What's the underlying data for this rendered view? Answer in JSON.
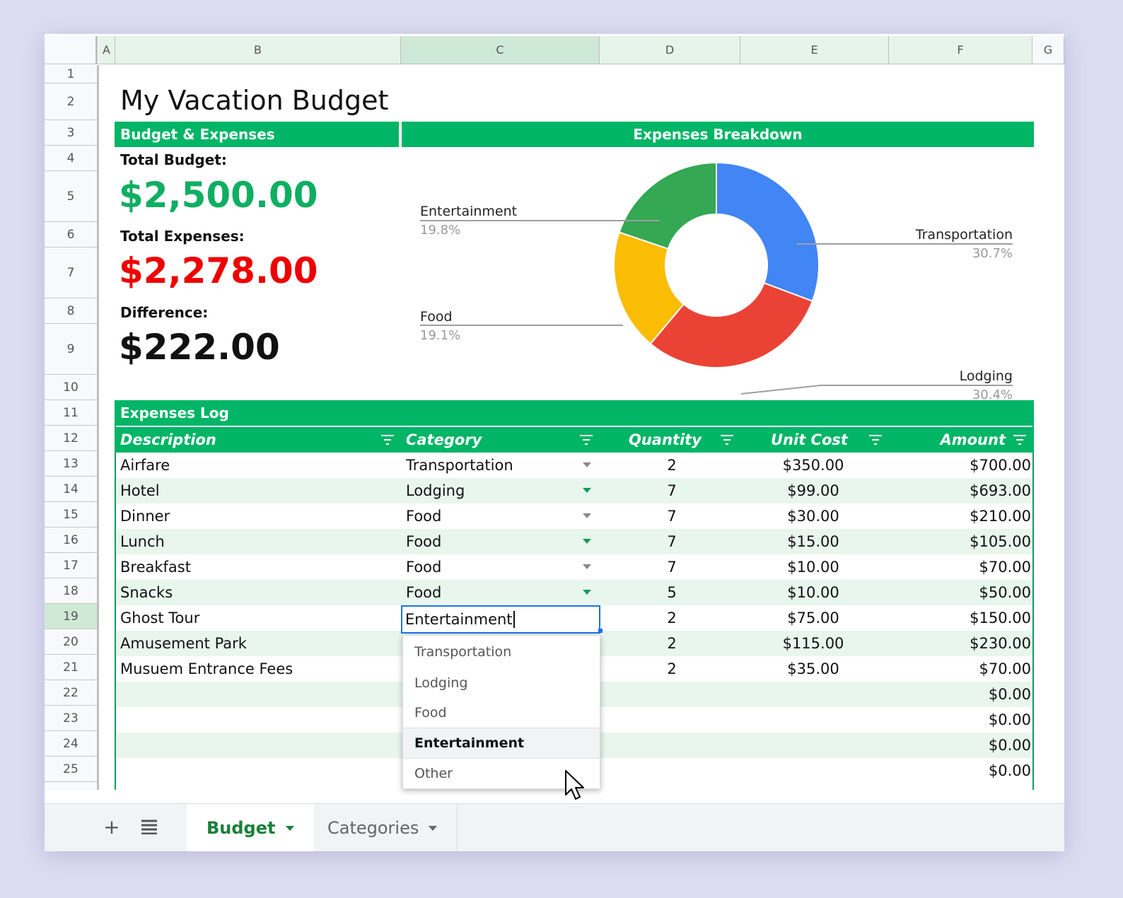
{
  "columns": [
    "A",
    "B",
    "C",
    "D",
    "E",
    "F",
    "G"
  ],
  "rows": [
    "1",
    "2",
    "3",
    "4",
    "5",
    "6",
    "7",
    "8",
    "9",
    "10",
    "11",
    "12",
    "13",
    "14",
    "15",
    "16",
    "17",
    "18",
    "19",
    "20",
    "21",
    "22",
    "23",
    "24",
    "25"
  ],
  "title": "My Vacation Budget",
  "summary": {
    "header": "Budget & Expenses",
    "total_budget_label": "Total Budget:",
    "total_budget": "$2,500.00",
    "total_expenses_label": "Total Expenses:",
    "total_expenses": "$2,278.00",
    "difference_label": "Difference:",
    "difference": "$222.00",
    "colors": {
      "budget": "#0fae62",
      "expenses": "#ee0000",
      "difference": "#111111"
    }
  },
  "chart_header": "Expenses Breakdown",
  "chart_data": {
    "type": "pie",
    "donut": true,
    "slices": [
      {
        "label": "Transportation",
        "percent": 30.7,
        "value": 700,
        "color": "#4285f4"
      },
      {
        "label": "Lodging",
        "percent": 30.4,
        "value": 693,
        "color": "#ea4335"
      },
      {
        "label": "Food",
        "percent": 19.1,
        "value": 435,
        "color": "#fbbc04"
      },
      {
        "label": "Entertainment",
        "percent": 19.8,
        "value": 450,
        "color": "#34a853"
      }
    ],
    "percent_labels": [
      "30.7%",
      "30.4%",
      "19.1%",
      "19.8%"
    ]
  },
  "log": {
    "header": "Expenses Log",
    "columns": [
      "Description",
      "Category",
      "Quantity",
      "Unit Cost",
      "Amount"
    ],
    "rows": [
      {
        "description": "Airfare",
        "category": "Transportation",
        "quantity": "2",
        "unit_cost": "$350.00",
        "amount": "$700.00"
      },
      {
        "description": "Hotel",
        "category": "Lodging",
        "quantity": "7",
        "unit_cost": "$99.00",
        "amount": "$693.00"
      },
      {
        "description": "Dinner",
        "category": "Food",
        "quantity": "7",
        "unit_cost": "$30.00",
        "amount": "$210.00"
      },
      {
        "description": "Lunch",
        "category": "Food",
        "quantity": "7",
        "unit_cost": "$15.00",
        "amount": "$105.00"
      },
      {
        "description": "Breakfast",
        "category": "Food",
        "quantity": "7",
        "unit_cost": "$10.00",
        "amount": "$70.00"
      },
      {
        "description": "Snacks",
        "category": "Food",
        "quantity": "5",
        "unit_cost": "$10.00",
        "amount": "$50.00"
      },
      {
        "description": "Ghost Tour",
        "category": "",
        "quantity": "2",
        "unit_cost": "$75.00",
        "amount": "$150.00"
      },
      {
        "description": "Amusement Park",
        "category": "",
        "quantity": "2",
        "unit_cost": "$115.00",
        "amount": "$230.00"
      },
      {
        "description": "Musuem Entrance Fees",
        "category": "",
        "quantity": "2",
        "unit_cost": "$35.00",
        "amount": "$70.00"
      },
      {
        "description": "",
        "category": "",
        "quantity": "",
        "unit_cost": "",
        "amount": "$0.00"
      },
      {
        "description": "",
        "category": "",
        "quantity": "",
        "unit_cost": "",
        "amount": "$0.00"
      },
      {
        "description": "",
        "category": "",
        "quantity": "",
        "unit_cost": "",
        "amount": "$0.00"
      },
      {
        "description": "",
        "category": "",
        "quantity": "",
        "unit_cost": "",
        "amount": "$0.00"
      }
    ]
  },
  "editing": {
    "value": "Entertainment",
    "options": [
      "Transportation",
      "Lodging",
      "Food",
      "Entertainment",
      "Other"
    ],
    "highlighted": "Entertainment"
  },
  "tabs": {
    "add_icon": "plus-icon",
    "list_icon": "list-icon",
    "sheets": [
      {
        "label": "Budget",
        "active": true
      },
      {
        "label": "Categories",
        "active": false
      }
    ]
  }
}
